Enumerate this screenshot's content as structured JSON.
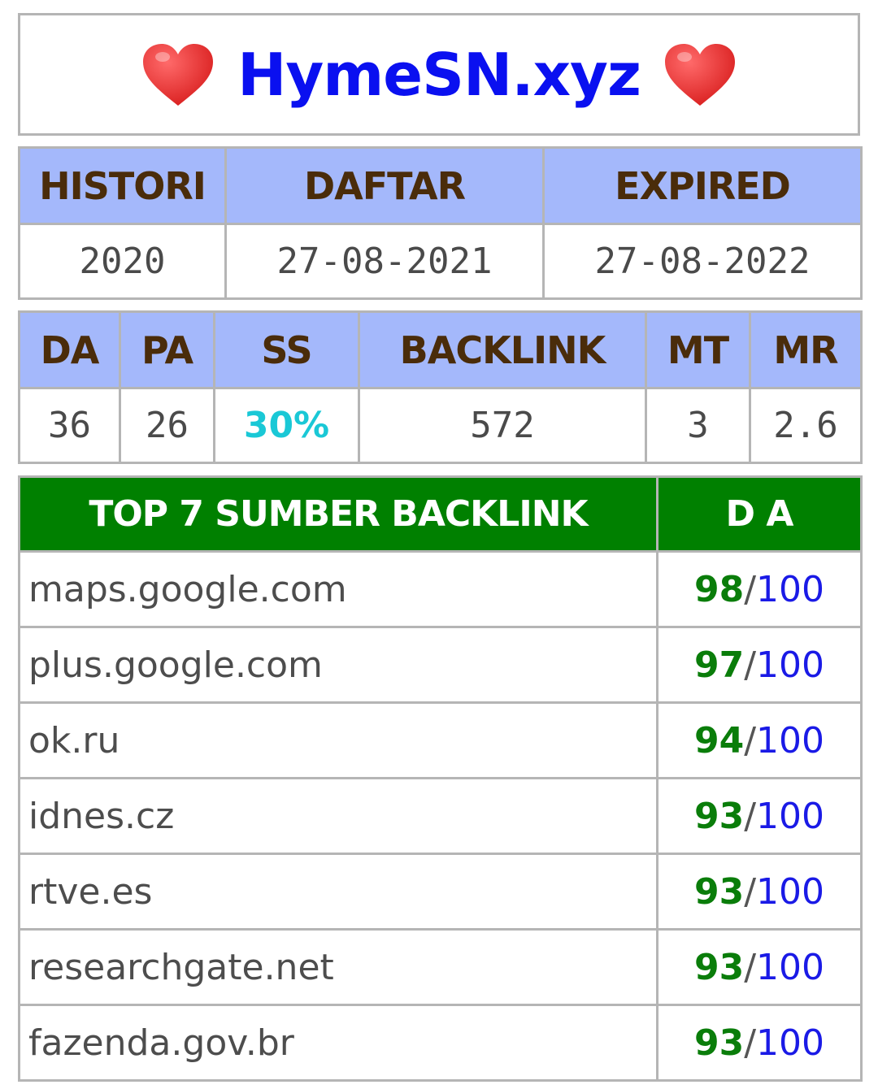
{
  "header": {
    "site_name": "HymeSN.xyz",
    "left_icon": "heart-icon",
    "right_icon": "heart-icon",
    "heart_color": "#e02c2c"
  },
  "domain_info": {
    "columns": [
      "HISTORI",
      "DAFTAR",
      "EXPIRED"
    ],
    "values": [
      "2020",
      "27-08-2021",
      "27-08-2022"
    ]
  },
  "metrics": {
    "columns": [
      "DA",
      "PA",
      "SS",
      "BACKLINK",
      "MT",
      "MR"
    ],
    "values": [
      "36",
      "26",
      "30%",
      "572",
      "3",
      "2.6"
    ]
  },
  "top_backlinks": {
    "title": "TOP 7 SUMBER BACKLINK",
    "score_header": "D A",
    "max_label": "100",
    "separator": "/",
    "rows": [
      {
        "domain": "maps.google.com",
        "da": "98"
      },
      {
        "domain": "plus.google.com",
        "da": "97"
      },
      {
        "domain": "ok.ru",
        "da": "94"
      },
      {
        "domain": "idnes.cz",
        "da": "93"
      },
      {
        "domain": "rtve.es",
        "da": "93"
      },
      {
        "domain": "researchgate.net",
        "da": "93"
      },
      {
        "domain": "fazenda.gov.br",
        "da": "93"
      }
    ]
  },
  "colors": {
    "title": "#0a10f0",
    "header_blue": "#a4b8fb",
    "header_green": "#008000",
    "ss_value": "#1ac8d6",
    "score_green": "#0a7d0a",
    "score_blue": "#1a1ae6"
  }
}
